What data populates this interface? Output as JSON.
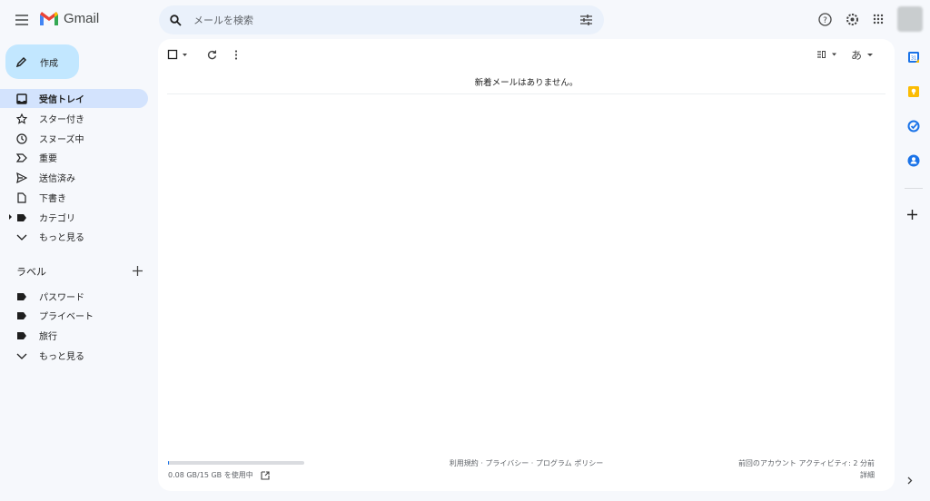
{
  "header": {
    "app_name": "Gmail",
    "search_placeholder": "メールを検索"
  },
  "compose_label": "作成",
  "sidebar": {
    "items": [
      {
        "label": "受信トレイ",
        "icon": "inbox-icon",
        "active": true
      },
      {
        "label": "スター付き",
        "icon": "star-icon"
      },
      {
        "label": "スヌーズ中",
        "icon": "clock-icon"
      },
      {
        "label": "重要",
        "icon": "important-icon"
      },
      {
        "label": "送信済み",
        "icon": "send-icon"
      },
      {
        "label": "下書き",
        "icon": "draft-icon"
      },
      {
        "label": "カテゴリ",
        "icon": "label-icon"
      },
      {
        "label": "もっと見る",
        "icon": "chevron-down-icon"
      }
    ],
    "labels_heading": "ラベル",
    "labels": [
      {
        "label": "パスワード",
        "icon": "label-icon"
      },
      {
        "label": "プライベート",
        "icon": "label-icon"
      },
      {
        "label": "旅行",
        "icon": "label-icon"
      },
      {
        "label": "もっと見る",
        "icon": "chevron-down-icon"
      }
    ]
  },
  "main": {
    "empty_message": "新着メールはありません。",
    "input_tool": "あ"
  },
  "footer": {
    "storage": "0.08 GB/15 GB を使用中",
    "storage_fraction": 0.0053,
    "links": "利用規約 · プライバシー · プログラム ポリシー",
    "activity": "前回のアカウント アクティビティ: 2 分前",
    "details": "詳細"
  },
  "colors": {
    "background": "#f6f8fc",
    "compose": "#c2e7ff",
    "active": "#d3e3fd",
    "search": "#eaf1fb"
  }
}
